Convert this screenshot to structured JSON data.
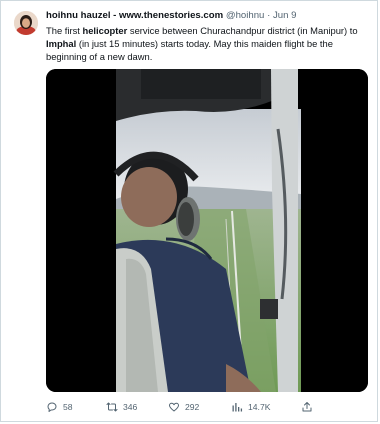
{
  "tweet": {
    "author_name": "hoihnu hauzel - www.thenestories.com",
    "handle": "@hoihnu",
    "separator": "·",
    "date": "Jun 9",
    "text": {
      "part1": "The first ",
      "bold1": "helicopter",
      "part2": " service between Churachandpur district (in Manipur) to ",
      "bold2": "Imphal",
      "part3": " (in just 15 minutes) starts today. May this maiden flight be the beginning of a new dawn."
    }
  },
  "actions": {
    "replies": "58",
    "retweets": "346",
    "likes": "292",
    "views": "14.7K"
  },
  "icons": {
    "reply": "speech-bubble-icon",
    "retweet": "retweet-arrows-icon",
    "like": "heart-icon",
    "views": "bar-chart-icon",
    "share": "share-upload-icon"
  },
  "colors": {
    "text": "#0f1419",
    "muted": "#536471",
    "border": "#cfd9de"
  }
}
